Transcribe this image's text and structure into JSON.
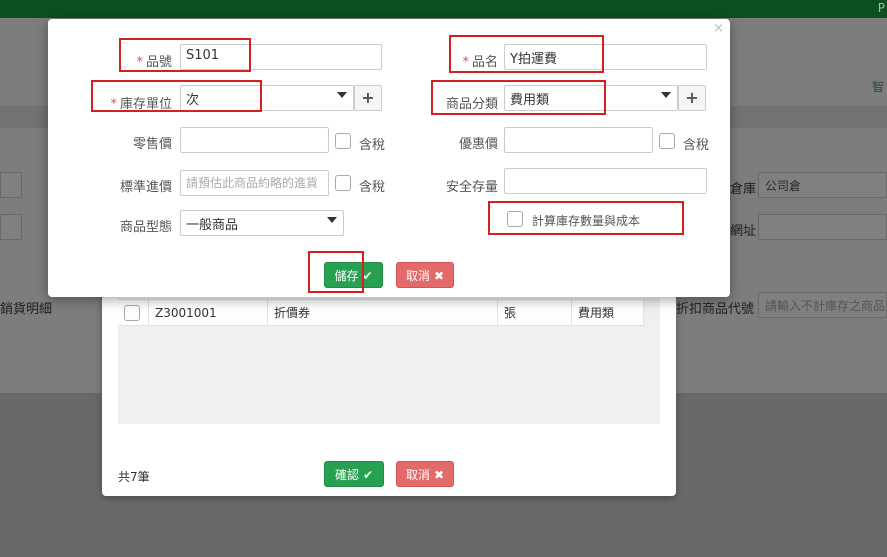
{
  "topbar": {
    "text": "P"
  },
  "background": {
    "smart_label": "智",
    "warehouse_label": "倉庫",
    "warehouse_value": "公司倉",
    "address_label": "網址",
    "detail_label": "銷貨明細",
    "discount_label": "折扣商品代號",
    "discount_placeholder": "請輸入不計庫存之商品"
  },
  "modal": {
    "close_icon": "×",
    "product_no": {
      "label": "品號",
      "value": "S101"
    },
    "product_name": {
      "label": "品名",
      "value": "Y拍運費"
    },
    "stock_unit": {
      "label": "庫存單位",
      "value": "次"
    },
    "category": {
      "label": "商品分類",
      "value": "費用類"
    },
    "retail_price": {
      "label": "零售價",
      "value": "",
      "tax_label": "含稅"
    },
    "discount_price": {
      "label": "優惠價",
      "value": "",
      "tax_label": "含稅"
    },
    "standard_cost": {
      "label": "標準進價",
      "placeholder": "請預估此商品約略的進貨",
      "tax_label": "含稅"
    },
    "safety_stock": {
      "label": "安全存量",
      "value": ""
    },
    "product_type": {
      "label": "商品型態",
      "value": "一般商品"
    },
    "calc_stock": {
      "label": "計算庫存數量與成本"
    },
    "save_label": "儲存",
    "cancel_label": "取消",
    "plus": "+"
  },
  "modal2": {
    "row": {
      "code": "Z3001001",
      "name": "折價券",
      "unit": "張",
      "category": "費用類"
    },
    "total": "共7筆",
    "confirm_label": "確認",
    "cancel_label": "取消"
  }
}
